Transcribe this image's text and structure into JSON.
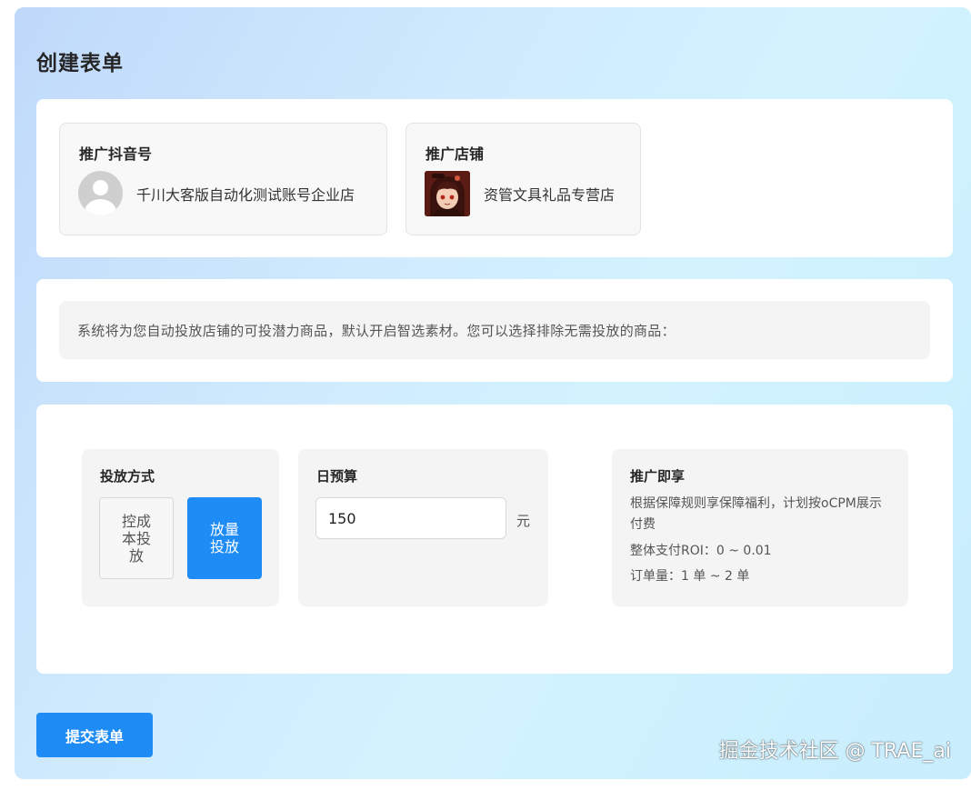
{
  "page": {
    "title": "创建表单"
  },
  "accounts": {
    "douyin": {
      "title": "推广抖音号",
      "name": "千川大客版自动化测试账号企业店",
      "avatar_icon": "default-user-avatar"
    },
    "shop": {
      "title": "推广店铺",
      "name": "资管文具礼品专营店",
      "avatar_icon": "anime-character-avatar"
    }
  },
  "notice": {
    "text": "系统将为您自动投放店铺的可投潜力商品，默认开启智选素材。您可以选择排除无需投放的商品："
  },
  "settings": {
    "mode": {
      "title": "投放方式",
      "options": [
        {
          "label": "控成本投放",
          "selected": false
        },
        {
          "label": "放量投放",
          "selected": true
        }
      ]
    },
    "budget": {
      "title": "日预算",
      "value": "150",
      "unit": "元"
    },
    "perks": {
      "title": "推广即享",
      "description": "根据保障规则享保障福利，计划按oCPM展示付费",
      "roi": "整体支付ROI：0 ~ 0.01",
      "orders": "订单量：1 单 ~ 2 单"
    }
  },
  "submit": {
    "label": "提交表单"
  },
  "watermark": {
    "text": "掘金技术社区 @ TRAE_ai"
  },
  "colors": {
    "primary": "#1f8cf5",
    "card_bg": "#ffffff",
    "panel_bg": "#f4f4f4"
  }
}
